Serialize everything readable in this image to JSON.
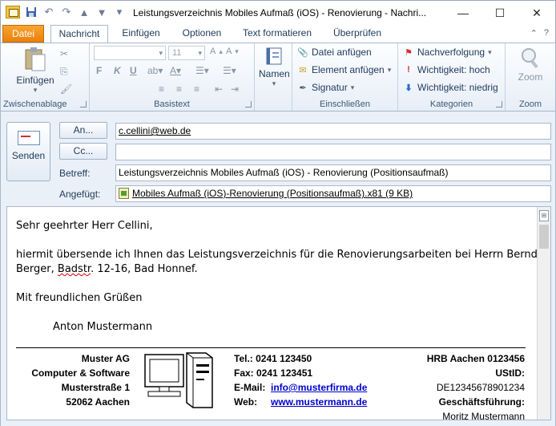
{
  "window": {
    "title": "Leistungsverzeichnis Mobiles Aufmaß (iOS) - Renovierung  -  Nachri..."
  },
  "tabs": [
    {
      "label": "Datei"
    },
    {
      "label": "Nachricht"
    },
    {
      "label": "Einfügen"
    },
    {
      "label": "Optionen"
    },
    {
      "label": "Text formatieren"
    },
    {
      "label": "Überprüfen"
    }
  ],
  "ribbon": {
    "clipboard": {
      "paste": "Einfügen",
      "group": "Zwischenablage"
    },
    "basictext": {
      "font_size": "11",
      "group": "Basistext"
    },
    "names": {
      "label": "Namen",
      "group": ""
    },
    "include": {
      "attach_file": "Datei anfügen",
      "attach_item": "Element anfügen",
      "signature": "Signatur",
      "group": "Einschließen"
    },
    "tags": {
      "followup": "Nachverfolgung",
      "high": "Wichtigkeit: hoch",
      "low": "Wichtigkeit: niedrig",
      "group": "Kategorien"
    },
    "zoom": {
      "label": "Zoom",
      "group": "Zoom"
    }
  },
  "header": {
    "send": "Senden",
    "to_btn": "An...",
    "cc_btn": "Cc...",
    "to_value": "c.cellini@web.de",
    "cc_value": "",
    "subject_label": "Betreff:",
    "subject_value": "Leistungsverzeichnis Mobiles Aufmaß (iOS) - Renovierung (Positionsaufmaß)",
    "attached_label": "Angefügt:",
    "attachment": "Mobiles Aufmaß (iOS)-Renovierung (Positionsaufmaß).x81 (9 KB)"
  },
  "mail": {
    "greeting": "Sehr geehrter Herr Cellini,",
    "line1": "hiermit übersende ich Ihnen das Leistungsverzeichnis für die Renovierungsarbeiten bei Herrn Bernd",
    "line2_a": "Berger, ",
    "line2_b": "Badstr",
    "line2_c": ". 12-16, Bad Honnef.",
    "closing": "Mit freundlichen Grüßen",
    "name": "Anton Mustermann"
  },
  "signature": {
    "company": [
      "Muster AG",
      "Computer & Software",
      "Musterstraße 1",
      "52062 Aachen"
    ],
    "tel": "Tel.: 0241 123450",
    "fax": "Fax: 0241 123451",
    "email_label": "E-Mail:",
    "email": "info@musterfirma.de",
    "web_label": "Web:",
    "web": "www.mustermann.de",
    "hrb": "HRB Aachen 0123456",
    "ustid_label": "UStID:",
    "ustid": "DE12345678901234",
    "gf_label": "Geschäftsführung:",
    "gf": "Moritz Mustermann"
  }
}
